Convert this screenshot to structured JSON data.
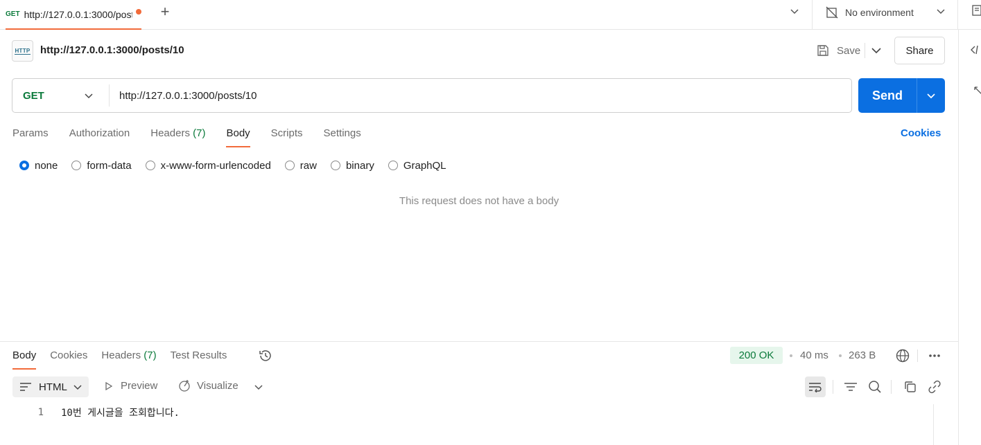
{
  "tab": {
    "method": "GET",
    "title": "http://127.0.0.1:3000/posts/10"
  },
  "environment": {
    "label": "No environment"
  },
  "request": {
    "name": "http://127.0.0.1:3000/posts/10",
    "http_badge": "HTTP",
    "save_label": "Save",
    "share_label": "Share",
    "method": "GET",
    "url": "http://127.0.0.1:3000/posts/10",
    "send_label": "Send"
  },
  "request_tabs": [
    {
      "label": "Params"
    },
    {
      "label": "Authorization"
    },
    {
      "label": "Headers",
      "count": "(7)"
    },
    {
      "label": "Body",
      "active": true
    },
    {
      "label": "Scripts"
    },
    {
      "label": "Settings"
    }
  ],
  "cookies_label": "Cookies",
  "body_types": [
    {
      "label": "none",
      "selected": true
    },
    {
      "label": "form-data"
    },
    {
      "label": "x-www-form-urlencoded"
    },
    {
      "label": "raw"
    },
    {
      "label": "binary"
    },
    {
      "label": "GraphQL"
    }
  ],
  "empty_body_message": "This request does not have a body",
  "response": {
    "tabs": [
      {
        "label": "Body",
        "active": true
      },
      {
        "label": "Cookies"
      },
      {
        "label": "Headers",
        "count": "(7)"
      },
      {
        "label": "Test Results"
      }
    ],
    "status": "200 OK",
    "time": "40 ms",
    "size": "263 B",
    "format": "HTML",
    "preview_label": "Preview",
    "visualize_label": "Visualize",
    "lines": [
      {
        "number": "1",
        "text": "10번 게시글을 조회합니다."
      }
    ]
  },
  "colors": {
    "accent_orange": "#f26b3a",
    "send_blue": "#0b6fe1",
    "method_green": "#0b7a3b",
    "status_bg": "#e6f6ec"
  }
}
